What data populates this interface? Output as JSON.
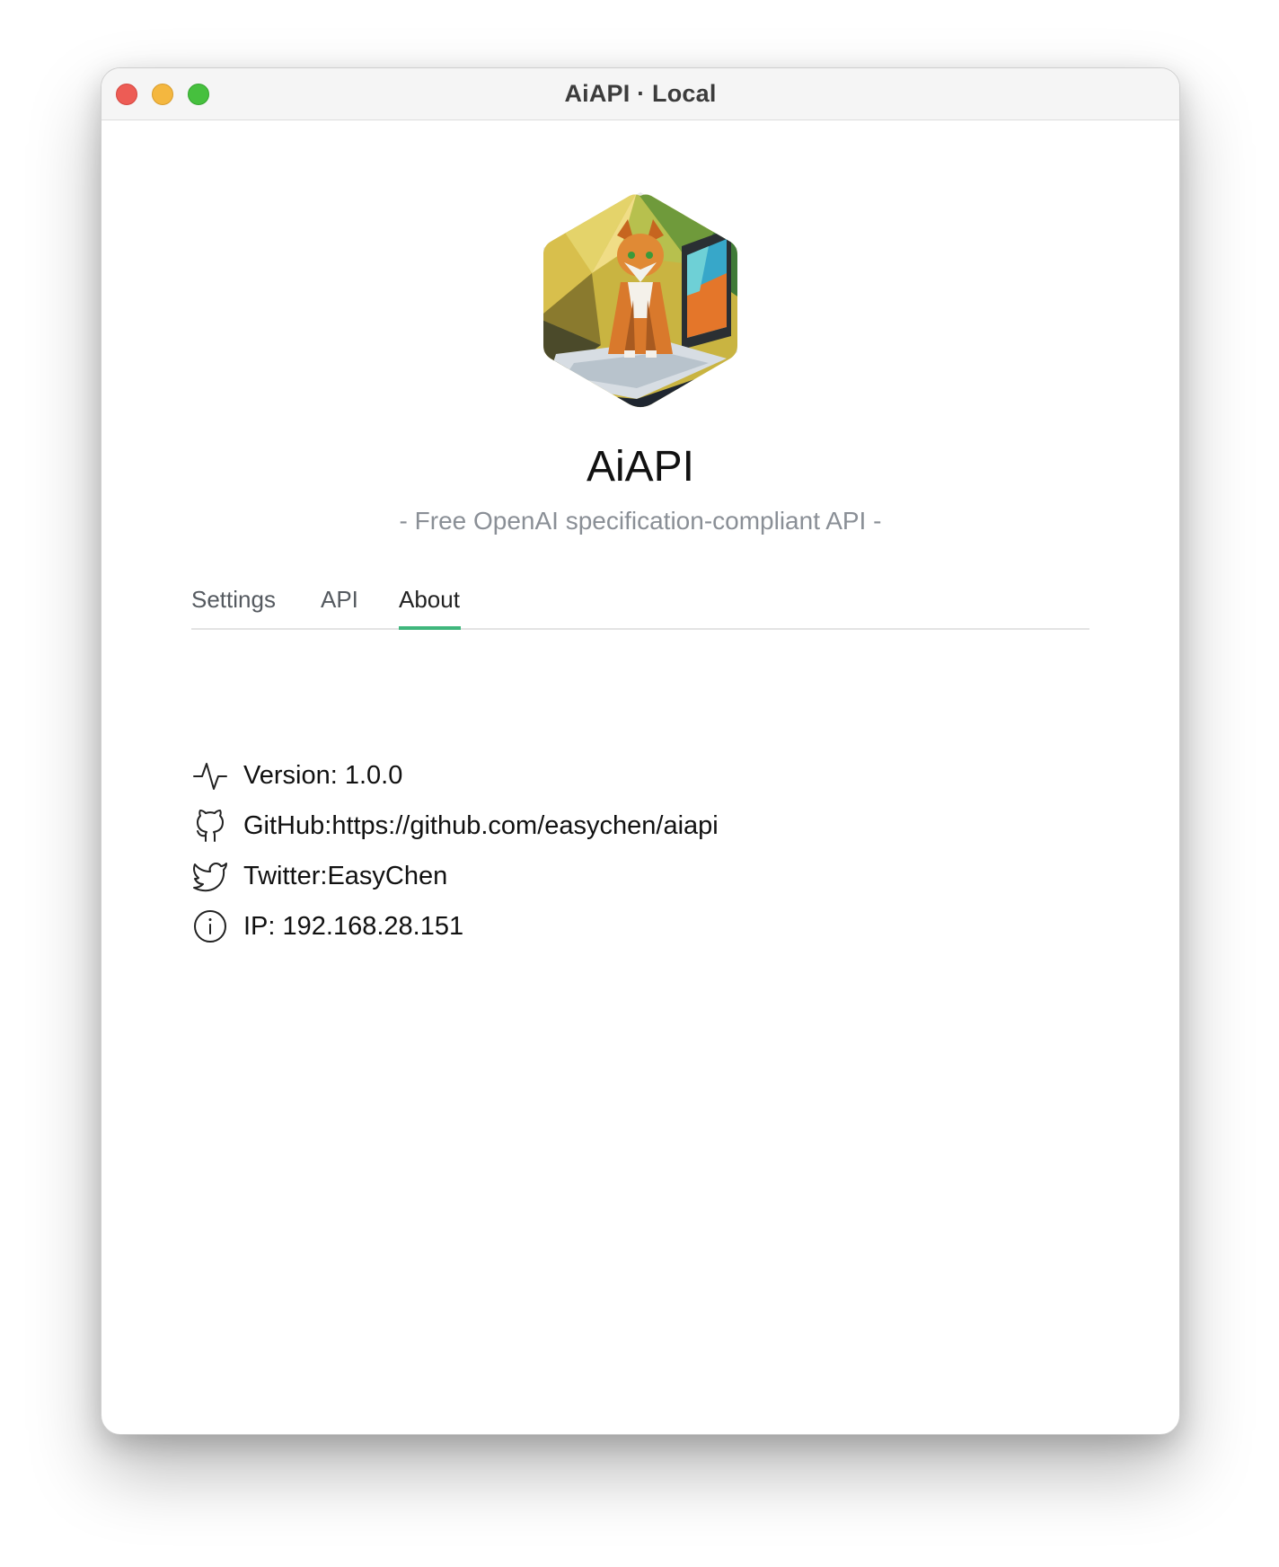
{
  "window": {
    "title": "AiAPI · Local"
  },
  "app": {
    "name": "AiAPI",
    "subtitle": "- Free OpenAI specification-compliant API -"
  },
  "tabs": [
    {
      "label": "Settings",
      "active": false
    },
    {
      "label": "API",
      "active": false
    },
    {
      "label": "About",
      "active": true
    }
  ],
  "about": {
    "items": [
      {
        "icon": "activity-icon",
        "text": "Version: 1.0.0"
      },
      {
        "icon": "github-icon",
        "text": "GitHub:https://github.com/easychen/aiapi"
      },
      {
        "icon": "twitter-icon",
        "text": "Twitter:EasyChen"
      },
      {
        "icon": "info-icon",
        "text": "IP: 192.168.28.151"
      }
    ]
  },
  "colors": {
    "accent": "#3fb67c",
    "subtitle": "#8a8f96",
    "close": "#ed5c55",
    "minimize": "#f4b73f",
    "maximize": "#46c03e"
  }
}
